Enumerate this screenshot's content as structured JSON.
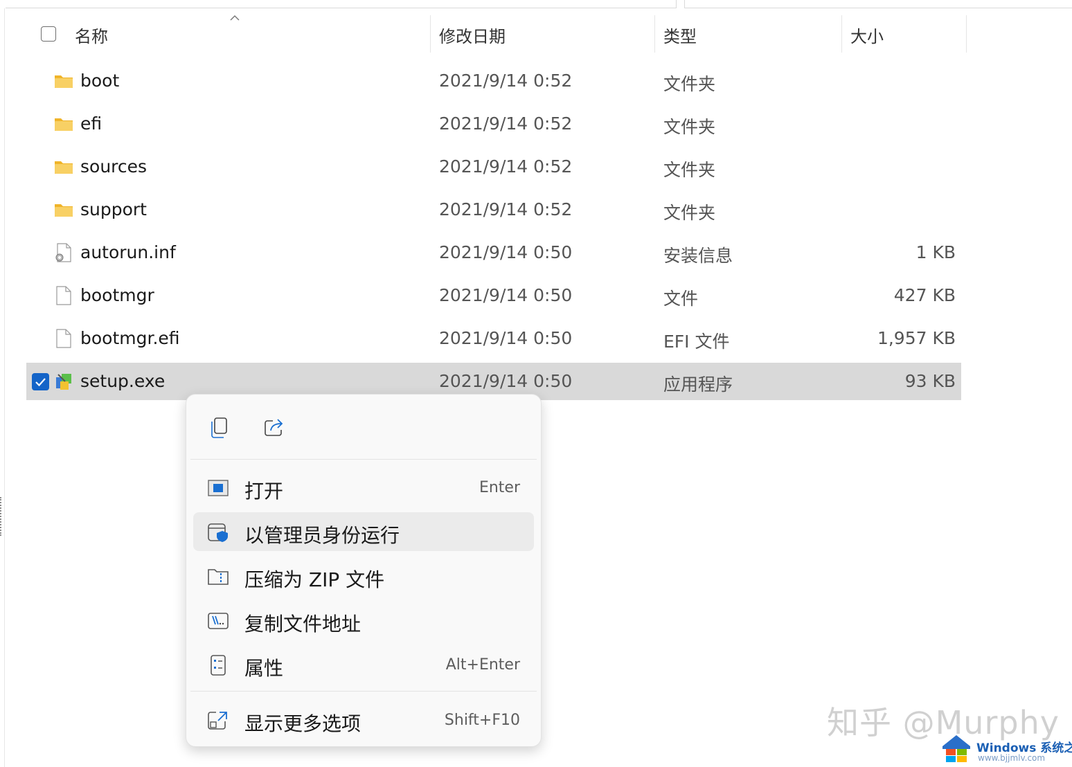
{
  "header": {
    "columns": [
      "名称",
      "修改日期",
      "类型",
      "大小"
    ]
  },
  "files": [
    {
      "name": "boot",
      "date": "2021/9/14 0:52",
      "type": "文件夹",
      "size": "",
      "icon": "folder-icon"
    },
    {
      "name": "efi",
      "date": "2021/9/14 0:52",
      "type": "文件夹",
      "size": "",
      "icon": "folder-icon"
    },
    {
      "name": "sources",
      "date": "2021/9/14 0:52",
      "type": "文件夹",
      "size": "",
      "icon": "folder-icon"
    },
    {
      "name": "support",
      "date": "2021/9/14 0:52",
      "type": "文件夹",
      "size": "",
      "icon": "folder-icon"
    },
    {
      "name": "autorun.inf",
      "date": "2021/9/14 0:50",
      "type": "安装信息",
      "size": "1 KB",
      "icon": "settings-file-icon"
    },
    {
      "name": "bootmgr",
      "date": "2021/9/14 0:50",
      "type": "文件",
      "size": "427 KB",
      "icon": "file-icon"
    },
    {
      "name": "bootmgr.efi",
      "date": "2021/9/14 0:50",
      "type": "EFI 文件",
      "size": "1,957 KB",
      "icon": "file-icon"
    },
    {
      "name": "setup.exe",
      "date": "2021/9/14 0:50",
      "type": "应用程序",
      "size": "93 KB",
      "icon": "setup-exe-icon",
      "selected": true
    }
  ],
  "context_menu": {
    "quick_actions": [
      "copy-icon",
      "share-icon"
    ],
    "items": [
      {
        "label": "打开",
        "shortcut": "Enter",
        "icon": "open-window-icon"
      },
      {
        "label": "以管理员身份运行",
        "shortcut": "",
        "icon": "admin-shield-icon"
      },
      {
        "label": "压缩为 ZIP 文件",
        "shortcut": "",
        "icon": "zip-folder-icon"
      },
      {
        "label": "复制文件地址",
        "shortcut": "",
        "icon": "copy-path-icon"
      },
      {
        "label": "属性",
        "shortcut": "Alt+Enter",
        "icon": "properties-icon"
      },
      {
        "label": "显示更多选项",
        "shortcut": "Shift+F10",
        "icon": "more-options-icon"
      }
    ]
  },
  "watermarks": {
    "zhihu": "知乎 @Murphy",
    "site_name_a": "Windows",
    "site_name_b": "系统之家",
    "site_url": "www.bjjmlv.com"
  },
  "colors": {
    "selection": "#d9d9d9",
    "accent": "#1464c8",
    "folder": "#f6c343"
  }
}
